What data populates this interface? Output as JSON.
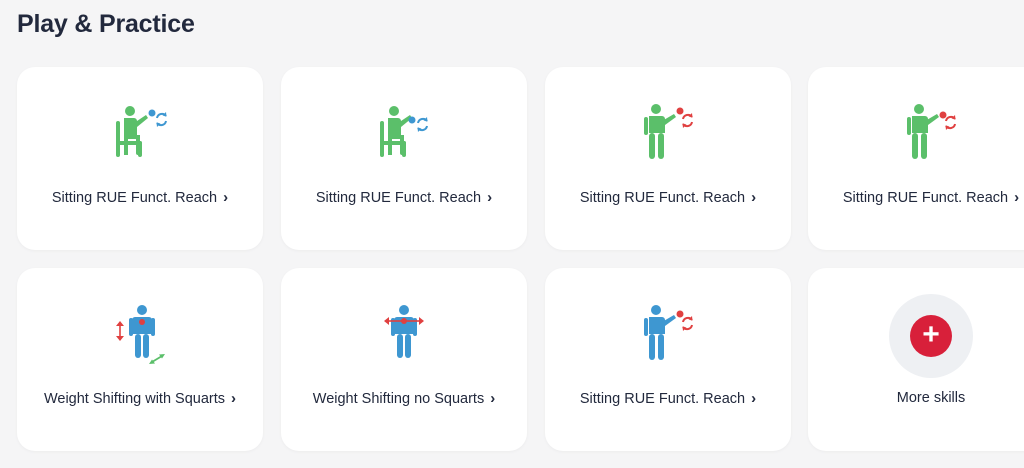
{
  "page": {
    "title": "Play & Practice"
  },
  "colors": {
    "green": "#5bbf6a",
    "blue": "#3e97d1",
    "red": "#e04040",
    "accent_red": "#d8203a"
  },
  "cards": [
    {
      "label": "Sitting RUE Funct. Reach",
      "icon": "seated-reach-icon"
    },
    {
      "label": "Sitting RUE Funct. Reach",
      "icon": "seated-reach-icon"
    },
    {
      "label": "Sitting RUE Funct. Reach",
      "icon": "standing-reach-icon"
    },
    {
      "label": "Sitting RUE Funct. Reach",
      "icon": "standing-reach-icon"
    },
    {
      "label": "Weight Shifting with Squarts",
      "icon": "weight-shift-squat-icon"
    },
    {
      "label": "Weight Shifting no Squarts",
      "icon": "weight-shift-icon"
    },
    {
      "label": "Sitting RUE Funct. Reach",
      "icon": "standing-reach-icon"
    }
  ],
  "more": {
    "label": "More skills",
    "icon": "plus-icon",
    "symbol": "+"
  },
  "chevron": "›"
}
